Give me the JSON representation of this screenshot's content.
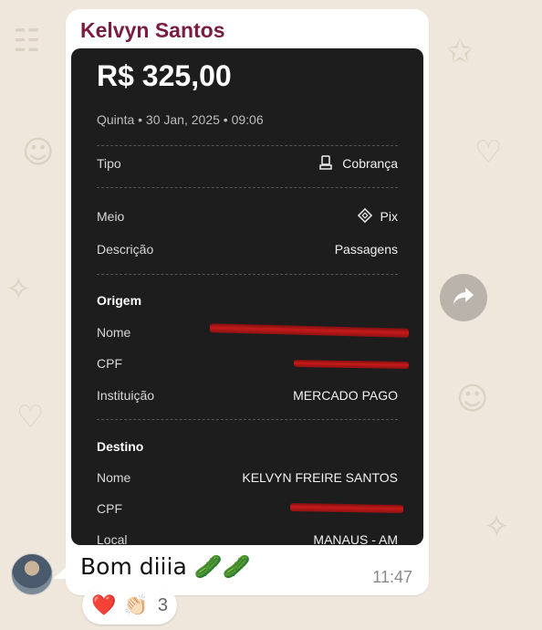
{
  "sender_name": "Kelvyn Santos",
  "receipt": {
    "amount": "R$ 325,00",
    "datetime": "Quinta • 30 Jan, 2025 • 09:06",
    "tipo_label": "Tipo",
    "tipo_value": "Cobrança",
    "meio_label": "Meio",
    "meio_value": "Pix",
    "descricao_label": "Descrição",
    "descricao_value": "Passagens",
    "origem": {
      "title": "Origem",
      "nome_label": "Nome",
      "cpf_label": "CPF",
      "instituicao_label": "Instituição",
      "instituicao_value": "MERCADO PAGO"
    },
    "destino": {
      "title": "Destino",
      "nome_label": "Nome",
      "nome_value": "KELVYN FREIRE SANTOS",
      "cpf_label": "CPF",
      "local_label": "Local",
      "local_value": "MANAUS - AM"
    }
  },
  "message": {
    "text": "Bom diiia 🥒🥒",
    "time": "11:47"
  },
  "reactions": {
    "emoji_1": "❤️",
    "emoji_2": "👏🏻",
    "count": "3"
  },
  "icons": {
    "tipo": "receipt-icon",
    "meio": "pix-icon",
    "forward": "forward-arrow-icon"
  }
}
